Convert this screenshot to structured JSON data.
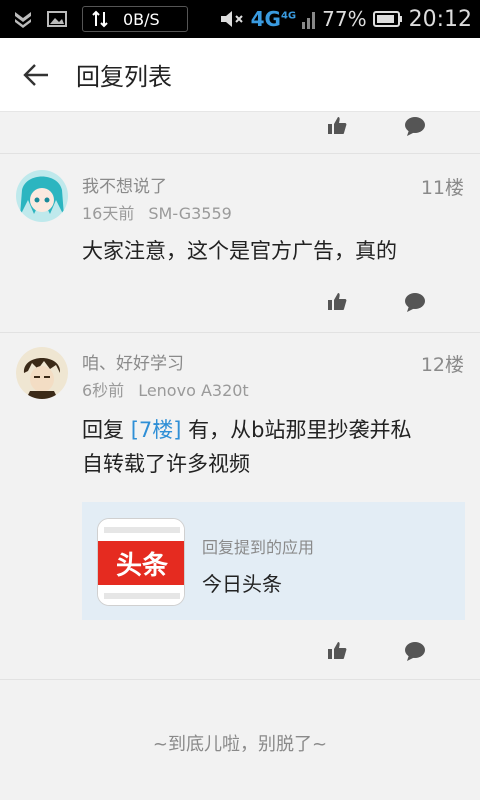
{
  "status_bar": {
    "speed": "0B/S",
    "network": "4G",
    "network_sup": "4G",
    "battery_percent": "77%",
    "time": "20:12"
  },
  "header": {
    "title": "回复列表"
  },
  "comments": [
    {
      "username": "我不想说了",
      "time_ago": "16天前",
      "device": "SM-G3559",
      "floor": "11楼",
      "body": "大家注意，这个是官方广告，真的"
    },
    {
      "username": "咱、好好学习",
      "time_ago": "6秒前",
      "device": "Lenovo A320t",
      "floor": "12楼",
      "reply_prefix": "回复 ",
      "reply_link": "[7楼]",
      "body_line1": " 有，从b站那里抄袭并私",
      "body_line2": "自转载了许多视频",
      "app_card": {
        "subtitle": "回复提到的应用",
        "app_name": "今日头条",
        "icon_text": "头条"
      }
    }
  ],
  "footer_text": "~到底儿啦，别脱了~"
}
